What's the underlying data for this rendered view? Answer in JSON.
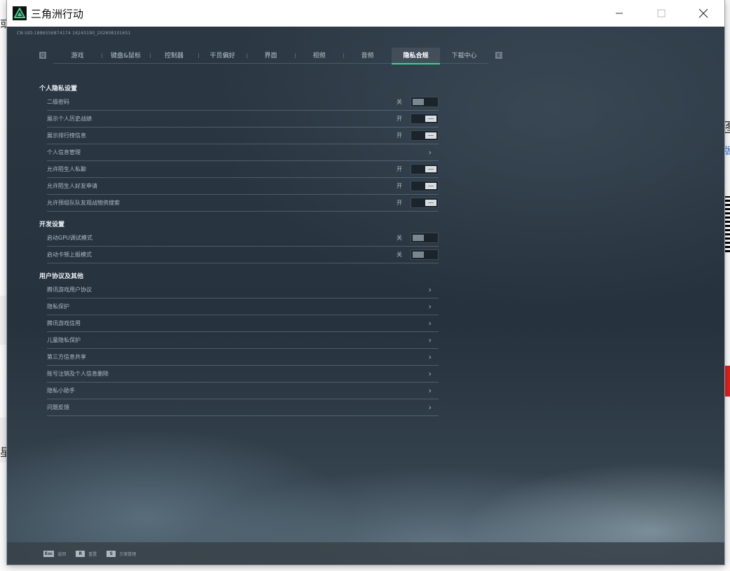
{
  "window": {
    "title": "三角洲行动"
  },
  "uid": "CN UID:1886556874174 16240190_202608101651",
  "tabs": [
    {
      "label": "游戏",
      "active": false
    },
    {
      "label": "键盘&鼠标",
      "active": false
    },
    {
      "label": "控制器",
      "active": false
    },
    {
      "label": "干员偏好",
      "active": false
    },
    {
      "label": "界面",
      "active": false
    },
    {
      "label": "视频",
      "active": false
    },
    {
      "label": "音频",
      "active": false
    },
    {
      "label": "隐私合规",
      "active": true
    },
    {
      "label": "下载中心",
      "active": false
    }
  ],
  "tab_prev_key": "Q",
  "tab_next_key": "E",
  "sections": {
    "privacy": {
      "title": "个人隐私设置",
      "items": [
        {
          "label": "二级密码",
          "state": "关"
        },
        {
          "label": "展示个人历史战绩",
          "state": "开"
        },
        {
          "label": "展示排行榜信息",
          "state": "开"
        },
        {
          "label": "个人信息管理"
        },
        {
          "label": "允许陌生人私聊",
          "state": "开"
        },
        {
          "label": "允许陌生人好友申请",
          "state": "开"
        },
        {
          "label": "允许预组队队友观战物资搜索",
          "state": "开"
        }
      ]
    },
    "dev": {
      "title": "开发设置",
      "items": [
        {
          "label": "启动GPU调试模式",
          "state": "关"
        },
        {
          "label": "启动卡顿上报模式",
          "state": "关"
        }
      ]
    },
    "agreements": {
      "title": "用户协议及其他",
      "items": [
        {
          "label": "腾讯游戏用户协议"
        },
        {
          "label": "隐私保护"
        },
        {
          "label": "腾讯游戏信用"
        },
        {
          "label": "儿童隐私保护"
        },
        {
          "label": "第三方信息共享"
        },
        {
          "label": "账号注销及个人信息删除"
        },
        {
          "label": "隐私小助手"
        },
        {
          "label": "问题反馈"
        }
      ]
    }
  },
  "footer": [
    {
      "key": "Esc",
      "label": "返回"
    },
    {
      "key": "R",
      "label": "重置"
    },
    {
      "key": "S",
      "label": "方案管理"
    }
  ],
  "colors": {
    "accent": "#3fd08c",
    "toggle_on": "#d9dee2",
    "toggle_off": "#7a8690"
  }
}
